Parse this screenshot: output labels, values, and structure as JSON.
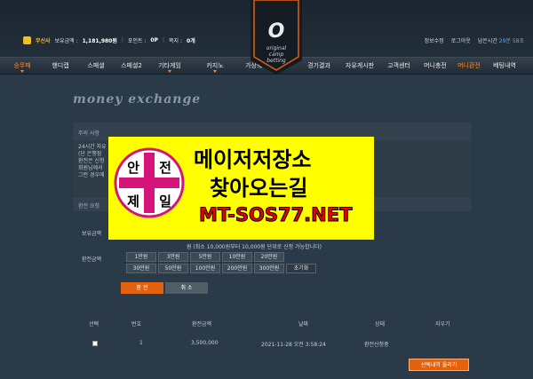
{
  "user": {
    "nickname": "무신사",
    "balance_label": "보유금액 :",
    "balance_value": "1,181,980원",
    "comp_label": "포인트 :",
    "comp_value": "0P",
    "note_label": "쪽지 :",
    "note_value": "0개"
  },
  "top_links": {
    "info": "정보수정",
    "logout": "로그아웃",
    "remain": "남은시간",
    "time": "29분 58초"
  },
  "nav": [
    {
      "label": "승무패"
    },
    {
      "label": "핸디캡"
    },
    {
      "label": "스페셜"
    },
    {
      "label": "스페셜2"
    },
    {
      "label": "기타게임"
    },
    {
      "label": "카지노"
    },
    {
      "label": "가상축구"
    },
    {
      "label": "경기결과"
    },
    {
      "label": "자유게시판"
    },
    {
      "label": "고객센터"
    },
    {
      "label": "머니충전"
    },
    {
      "label": "머니환전"
    },
    {
      "label": "베팅내역"
    }
  ],
  "logo": {
    "letter": "O",
    "line1": "original",
    "line2": "camp",
    "line3": "betting"
  },
  "page_title": "money exchange",
  "notice": {
    "header": "주의 사항",
    "lines": [
      "24시간 자유",
      "(단 은행점",
      "환전은 신청",
      "회원님께서",
      "그런 경우에"
    ]
  },
  "exchange": {
    "header": "환전 요청",
    "balance_label": "보유금액",
    "amount_label": "환전금액",
    "note": "원 (최소 10,000원부터 10,000원 단위로 신청 가능합니다)",
    "amount_buttons_row1": [
      "1만원",
      "3만원",
      "5만원",
      "10만원",
      "20만원"
    ],
    "amount_buttons_row2": [
      "30만원",
      "50만원",
      "100만원",
      "200만원",
      "300만원"
    ],
    "reset_label": "초기화",
    "submit_label": "환 전",
    "cancel_label": "취 소"
  },
  "table": {
    "headers": [
      "선택",
      "번호",
      "환전금액",
      "날짜",
      "상태",
      "지우기"
    ],
    "rows": [
      {
        "no": "1",
        "amount": "3,500,000",
        "date": "2021-11-28 오전 3:58:24",
        "status": "환전신청중"
      }
    ],
    "delete_selected_label": "선택내역 올리기"
  },
  "ad": {
    "logo_chars": [
      "안",
      "전",
      "제",
      "일"
    ],
    "line1": "메이저저장소",
    "line2": "찾아오는길",
    "line3": "MT-SOS77.NET"
  },
  "colors": {
    "accent": "#e2620e",
    "ad_bg": "#ffff00",
    "ad_url": "#e60000",
    "logo_cross": "#d4147a"
  }
}
